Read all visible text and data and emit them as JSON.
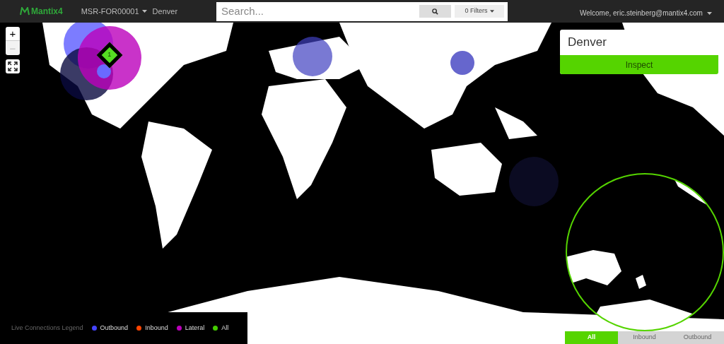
{
  "header": {
    "logo": "Mantix4",
    "sensor": "MSR-FOR00001",
    "location": "Denver",
    "search": {
      "placeholder": "Search..."
    },
    "filters": "0 Filters",
    "welcome": "Welcome, eric.steinberg@mantix4.com"
  },
  "map": {
    "zoom_in": "+",
    "zoom_out": "−",
    "marker": "1"
  },
  "panel": {
    "title": "Denver",
    "button": "Inspect"
  },
  "legend": {
    "title": "Live Connections Legend",
    "items": [
      {
        "label": "Outbound",
        "color": "#4444ff"
      },
      {
        "label": "Inbound",
        "color": "#ff4400"
      },
      {
        "label": "Lateral",
        "color": "#bb00bb"
      },
      {
        "label": "All",
        "color": "#44cc00"
      }
    ]
  },
  "tabs": [
    {
      "label": "All",
      "selected": true
    },
    {
      "label": "Inbound",
      "selected": false
    },
    {
      "label": "Outbound",
      "selected": false
    }
  ]
}
